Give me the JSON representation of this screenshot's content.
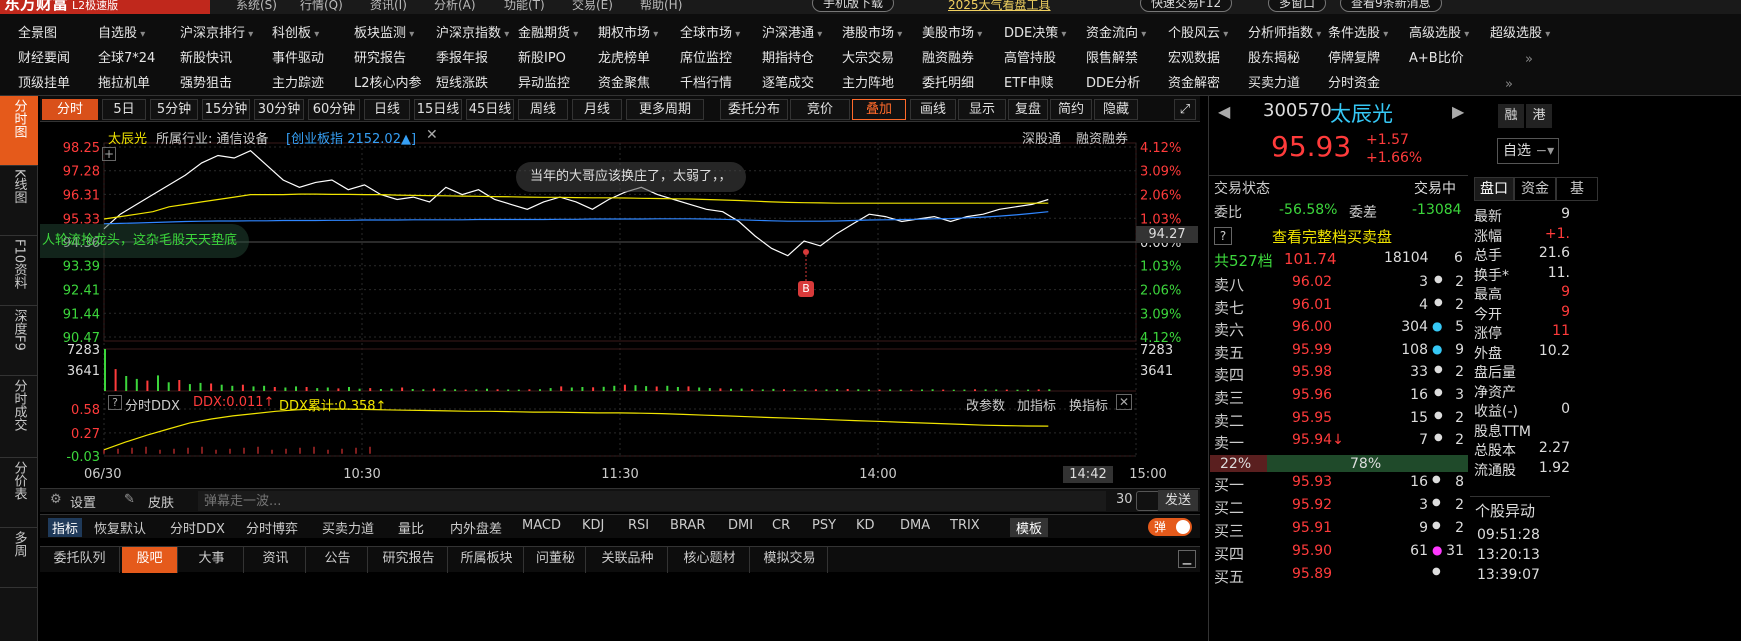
{
  "app": {
    "logo": "东方财富",
    "edition": "L2极速版",
    "top_menus": [
      "系统(S)",
      "行情(Q)",
      "资讯(I)",
      "分析(A)",
      "功能(T)",
      "交易(E)",
      "帮助(H)"
    ],
    "btn_mobile": "手机版下载",
    "btn_promo": "2025大气看盘工具",
    "btn_quick_trade": "快速交易F12",
    "btn_multi": "多窗口",
    "btn_news": "查看9条新消息"
  },
  "menu_rows": [
    [
      "全景图",
      "自选股",
      "沪深京排行",
      "科创板",
      "板块监测",
      "沪深京指数",
      "金融期货",
      "期权市场",
      "全球市场",
      "沪深港通",
      "港股市场",
      "美股市场",
      "DDE决策",
      "资金流向",
      "个股风云",
      "分析师指数",
      "条件选股",
      "高级选股",
      "超级选股"
    ],
    [
      "财经要闻",
      "全球7*24",
      "新股快讯",
      "事件驱动",
      "研究报告",
      "季报年报",
      "新股IPO",
      "龙虎榜单",
      "席位监控",
      "期指持仓",
      "大宗交易",
      "融资融券",
      "高管持股",
      "限售解禁",
      "宏观数据",
      "股东揭秘",
      "停牌复牌",
      "A+B比价"
    ],
    [
      "顶级挂单",
      "拖拉机单",
      "强势狙击",
      "主力踪迹",
      "L2核心内参",
      "短线涨跌",
      "异动监控",
      "资金聚焦",
      "千档行情",
      "逐笔成交",
      "主力阵地",
      "委托明细",
      "ETF申赎",
      "DDE分析",
      "资金解密",
      "买卖力道",
      "分时资金"
    ]
  ],
  "left_tabs": [
    {
      "label": "分时图",
      "active": true
    },
    {
      "label": "K线图",
      "active": false
    },
    {
      "label": "F10资料",
      "active": false
    },
    {
      "label": "深度F9",
      "active": false
    },
    {
      "label": "分时成交",
      "active": false
    },
    {
      "label": "分价表",
      "active": false
    },
    {
      "label": "多周",
      "active": false
    }
  ],
  "toolbar": {
    "tabs": [
      "分时",
      "5日",
      "5分钟",
      "15分钟",
      "30分钟",
      "60分钟",
      "日线",
      "15日线",
      "45日线",
      "周线",
      "月线",
      "更多周期"
    ],
    "right": [
      "委托分布",
      "竞价",
      "叠加",
      "画线",
      "显示",
      "复盘",
      "简约",
      "隐藏"
    ]
  },
  "chart_header": {
    "name": "太辰光",
    "industry_label": "所属行业: 通信设备",
    "index_label": "[创业板指 2152.02▲]",
    "right1": "深股通",
    "right2": "融资融券"
  },
  "annotations": {
    "bubble1": "当年的大哥应该换庄了，太弱了，，",
    "bubble2": "人轮流抢龙头，这杂毛股天天垫底",
    "marker": "B",
    "current_price_tag": "94.27"
  },
  "chart_data": [
    {
      "type": "line",
      "title": "",
      "x_ticks": [
        "06/30",
        "10:30",
        "11:30",
        "14:00",
        "15:00"
      ],
      "current_time_tag": "14:42",
      "y_ticks_left": [
        "98.25",
        "97.28",
        "96.31",
        "95.33",
        "94.36",
        "93.39",
        "92.41",
        "91.44",
        "90.47"
      ],
      "y_ticks_right": [
        "4.12%",
        "3.09%",
        "2.06%",
        "1.03%",
        "0.00%",
        "1.03%",
        "2.06%",
        "3.09%",
        "4.12%"
      ],
      "prev_close": 94.36,
      "ylim": [
        90.47,
        98.25
      ],
      "series": [
        {
          "values": [
            94.9,
            95.5,
            95.9,
            96.3,
            96.7,
            97.1,
            97.6,
            97.9,
            97.8,
            98.1,
            97.5,
            96.9,
            96.6,
            96.8,
            96.9,
            96.5,
            96.7,
            96.3,
            96.1,
            96.2,
            96.0,
            96.6,
            96.3,
            96.5,
            96.1,
            95.9,
            95.7,
            96.0,
            96.2,
            96.0,
            95.7,
            96.1,
            96.4,
            96.6,
            96.3,
            96.1,
            95.9,
            95.7,
            95.6,
            95.2,
            94.6,
            94.1,
            93.8,
            94.4,
            94.2,
            94.7,
            95.1,
            95.5,
            95.4,
            95.2,
            95.3,
            95.4,
            95.2,
            95.4,
            95.5,
            95.7,
            95.8,
            95.9,
            96.1
          ]
        },
        {
          "values": [
            95.3,
            95.4,
            95.5,
            95.6,
            95.8,
            95.9,
            96.0,
            96.1,
            96.2,
            96.3,
            96.3,
            96.3,
            96.32,
            96.32,
            96.31,
            96.31,
            96.3,
            96.3,
            96.28,
            96.27,
            96.26,
            96.25,
            96.24,
            96.23,
            96.22,
            96.21,
            96.2,
            96.19,
            96.19,
            96.18,
            96.17,
            96.17,
            96.16,
            96.15,
            96.14,
            96.13,
            96.12,
            96.1,
            96.08,
            96.06,
            96.03,
            96.0,
            95.98,
            95.97,
            95.96,
            95.95,
            95.95,
            95.95,
            95.95,
            95.95,
            95.95,
            95.95,
            95.95,
            95.95,
            95.95,
            95.95,
            95.95,
            95.95,
            95.95
          ]
        },
        {
          "values": [
            95.1,
            95.12,
            95.14,
            95.16,
            95.18,
            95.2,
            95.21,
            95.22,
            95.22,
            95.23,
            95.23,
            95.24,
            95.24,
            95.24,
            95.25,
            95.25,
            95.26,
            95.26,
            95.26,
            95.27,
            95.27,
            95.27,
            95.27,
            95.28,
            95.28,
            95.28,
            95.28,
            95.28,
            95.29,
            95.29,
            95.3,
            95.3,
            95.3,
            95.3,
            95.31,
            95.31,
            95.31,
            95.3,
            95.29,
            95.27,
            95.25,
            95.23,
            95.21,
            95.21,
            95.21,
            95.22,
            95.24,
            95.26,
            95.27,
            95.28,
            95.29,
            95.31,
            95.32,
            95.35,
            95.38,
            95.42,
            95.47,
            95.53,
            95.6
          ]
        }
      ]
    },
    {
      "type": "bar",
      "title": "",
      "y_ticks": [
        "7283",
        "3641"
      ],
      "ylim": [
        0,
        7283
      ],
      "values": [
        7283,
        3800,
        2600,
        2100,
        1800,
        2700,
        1500,
        1900,
        1200,
        1400,
        1300,
        1100,
        900,
        1100,
        800,
        900,
        700,
        600,
        800,
        700,
        500,
        600,
        450,
        700,
        400,
        500,
        350,
        400,
        600,
        350,
        300,
        420,
        380,
        300,
        250,
        280,
        400,
        300,
        260,
        240,
        300,
        320,
        500,
        800,
        600,
        700,
        650,
        720,
        900,
        1100,
        1000,
        850,
        780,
        900,
        700,
        800,
        600,
        500,
        450,
        380,
        420,
        300,
        280,
        360,
        300,
        250,
        260,
        300,
        280,
        320,
        350,
        300,
        260,
        250,
        280,
        240,
        220,
        260,
        300,
        240,
        220,
        250,
        300,
        280,
        260,
        240,
        230,
        250,
        270,
        300
      ]
    },
    {
      "type": "line",
      "title": "分时DDX",
      "labels": [
        "DDX:0.011↑",
        "DDX累计:0.358↑"
      ],
      "right_links": [
        "改参数",
        "加指标",
        "换指标"
      ],
      "y_ticks": [
        "0.58",
        "0.27",
        "-0.03"
      ],
      "ylim": [
        -0.03,
        0.58
      ],
      "series": [
        {
          "values": [
            0.05,
            0.15,
            0.24,
            0.32,
            0.4,
            0.45,
            0.49,
            0.52,
            0.55,
            0.57,
            0.58,
            0.58,
            0.575,
            0.57,
            0.565,
            0.56,
            0.555,
            0.55,
            0.55,
            0.545,
            0.54,
            0.54,
            0.535,
            0.53,
            0.53,
            0.525,
            0.52,
            0.51,
            0.5,
            0.49,
            0.48,
            0.47,
            0.46,
            0.45,
            0.44,
            0.43,
            0.42,
            0.41,
            0.4,
            0.39,
            0.38,
            0.37,
            0.365,
            0.36,
            0.358
          ]
        }
      ]
    }
  ],
  "bottom_bar1": {
    "settings": "设置",
    "skin": "皮肤",
    "danmu_placeholder": "弹幕走一波...",
    "count": "30",
    "send": "发送"
  },
  "bottom_bar2": {
    "items": [
      "指标",
      "恢复默认",
      "分时DDX",
      "分时博弈",
      "买卖力道",
      "量比",
      "内外盘差",
      "MACD",
      "KDJ",
      "RSI",
      "BRAR",
      "DMI",
      "CR",
      "PSY",
      "KD",
      "DMA",
      "TRIX",
      "模板"
    ],
    "toggle_label": "弹"
  },
  "bottom_bar3": {
    "items": [
      "委托队列",
      "股吧",
      "大事",
      "资讯",
      "公告",
      "研究报告",
      "所属板块",
      "问董秘",
      "关联品种",
      "核心题材",
      "模拟交易"
    ]
  },
  "quote": {
    "code": "300570",
    "name": "太辰光",
    "price": "95.93",
    "change": "+1.57",
    "change_pct": "+1.66%",
    "btn_margin": "融",
    "btn_hk": "港",
    "btn_watch": "自选",
    "status_label": "交易状态",
    "status_value": "交易中",
    "wb_label": "委比",
    "wb_value": "-56.58%",
    "wc_label": "委差",
    "wc_value": "-13084",
    "full_book": "查看完整档买卖盘",
    "levels_label": "共527档",
    "levels_price": "101.74",
    "levels_vol": "18104",
    "levels_cnt": "6",
    "sells": [
      {
        "label": "卖八",
        "price": "96.02",
        "vol": "3",
        "dot": "",
        "cnt": "2"
      },
      {
        "label": "卖七",
        "price": "96.01",
        "vol": "4",
        "dot": "",
        "cnt": "2"
      },
      {
        "label": "卖六",
        "price": "96.00",
        "vol": "304",
        "dot": "cyan",
        "cnt": "5"
      },
      {
        "label": "卖五",
        "price": "95.99",
        "vol": "108",
        "dot": "cyan",
        "cnt": "9"
      },
      {
        "label": "卖四",
        "price": "95.98",
        "vol": "33",
        "dot": "",
        "cnt": "2"
      },
      {
        "label": "卖三",
        "price": "95.96",
        "vol": "16",
        "dot": "",
        "cnt": "3"
      },
      {
        "label": "卖二",
        "price": "95.95",
        "vol": "15",
        "dot": "",
        "cnt": "2"
      },
      {
        "label": "卖一",
        "price": "95.94↓",
        "vol": "7",
        "dot": "",
        "cnt": "2"
      }
    ],
    "ratio_sell": "22%",
    "ratio_buy": "78%",
    "ratio_value": 0.22,
    "buys": [
      {
        "label": "买一",
        "price": "95.93",
        "vol": "16",
        "dot": "",
        "cnt": "8"
      },
      {
        "label": "买二",
        "price": "95.92",
        "vol": "3",
        "dot": "",
        "cnt": "2"
      },
      {
        "label": "买三",
        "price": "95.91",
        "vol": "9",
        "dot": "",
        "cnt": "2"
      },
      {
        "label": "买四",
        "price": "95.90",
        "vol": "61",
        "dot": "magenta",
        "cnt": "31"
      },
      {
        "label": "买五",
        "price": "95.89",
        "vol": "",
        "dot": "",
        "cnt": ""
      }
    ],
    "tabs": [
      "盘口",
      "资金",
      "基"
    ],
    "stats": [
      {
        "k": "最新",
        "v": "9"
      },
      {
        "k": "涨幅",
        "v": "+1."
      },
      {
        "k": "总手",
        "v": "21.6"
      },
      {
        "k": "换手*",
        "v": "11."
      },
      {
        "k": "最高",
        "v": "9"
      },
      {
        "k": "今开",
        "v": "9"
      },
      {
        "k": "涨停",
        "v": "11"
      },
      {
        "k": "外盘",
        "v": "10.2"
      },
      {
        "k": "盘后量",
        "v": ""
      },
      {
        "k": "净资产",
        "v": ""
      },
      {
        "k": "收益(-)",
        "v": "0"
      },
      {
        "k": "股息TTM",
        "v": ""
      },
      {
        "k": "总股本",
        "v": "2.27"
      },
      {
        "k": "流通股",
        "v": "1.92"
      }
    ],
    "abnormal_title": "个股异动",
    "abnormal_times": [
      "09:51:28",
      "13:20:13",
      "13:39:07"
    ]
  }
}
